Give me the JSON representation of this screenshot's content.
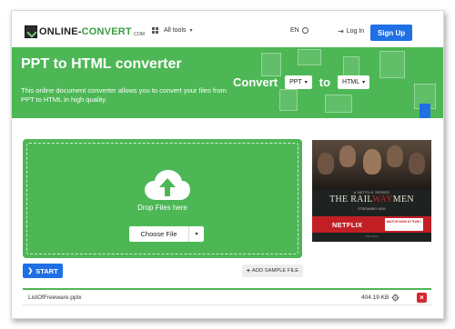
{
  "header": {
    "logo_main": "ONLINE-",
    "logo_accent": "CONVERT",
    "logo_suffix": ".COM",
    "all_tools_label": "All tools",
    "language": "EN",
    "login_label": "Log In",
    "signup_label": "Sign Up",
    "signup_color": "#1f6fe5"
  },
  "hero": {
    "title": "PPT to HTML converter",
    "description": "This online document converter allows you to convert your files from PPT to HTML in high quality.",
    "convert_label": "Convert",
    "from_format": "PPT",
    "to_label": "to",
    "to_format": "HTML",
    "background_color": "#4db755"
  },
  "upload": {
    "drop_text": "Drop Files here",
    "choose_file_label": "Choose File"
  },
  "ad": {
    "brand": "A NETFLIX SERIES",
    "title_part1": "THE RAIL",
    "title_part2": "WAY",
    "title_part3": "MEN",
    "tagline": "STREAMING NOW",
    "netflix_label": "NETFLIX",
    "watch_label": "WATCH NOW AT ₹199 !",
    "apply_label": "T&C Apply"
  },
  "actions": {
    "start_label": "START",
    "add_sample_label": "ADD SAMPLE FILE"
  },
  "file": {
    "name": "ListOfFreeware.pptx",
    "size": "404.19 KB"
  }
}
